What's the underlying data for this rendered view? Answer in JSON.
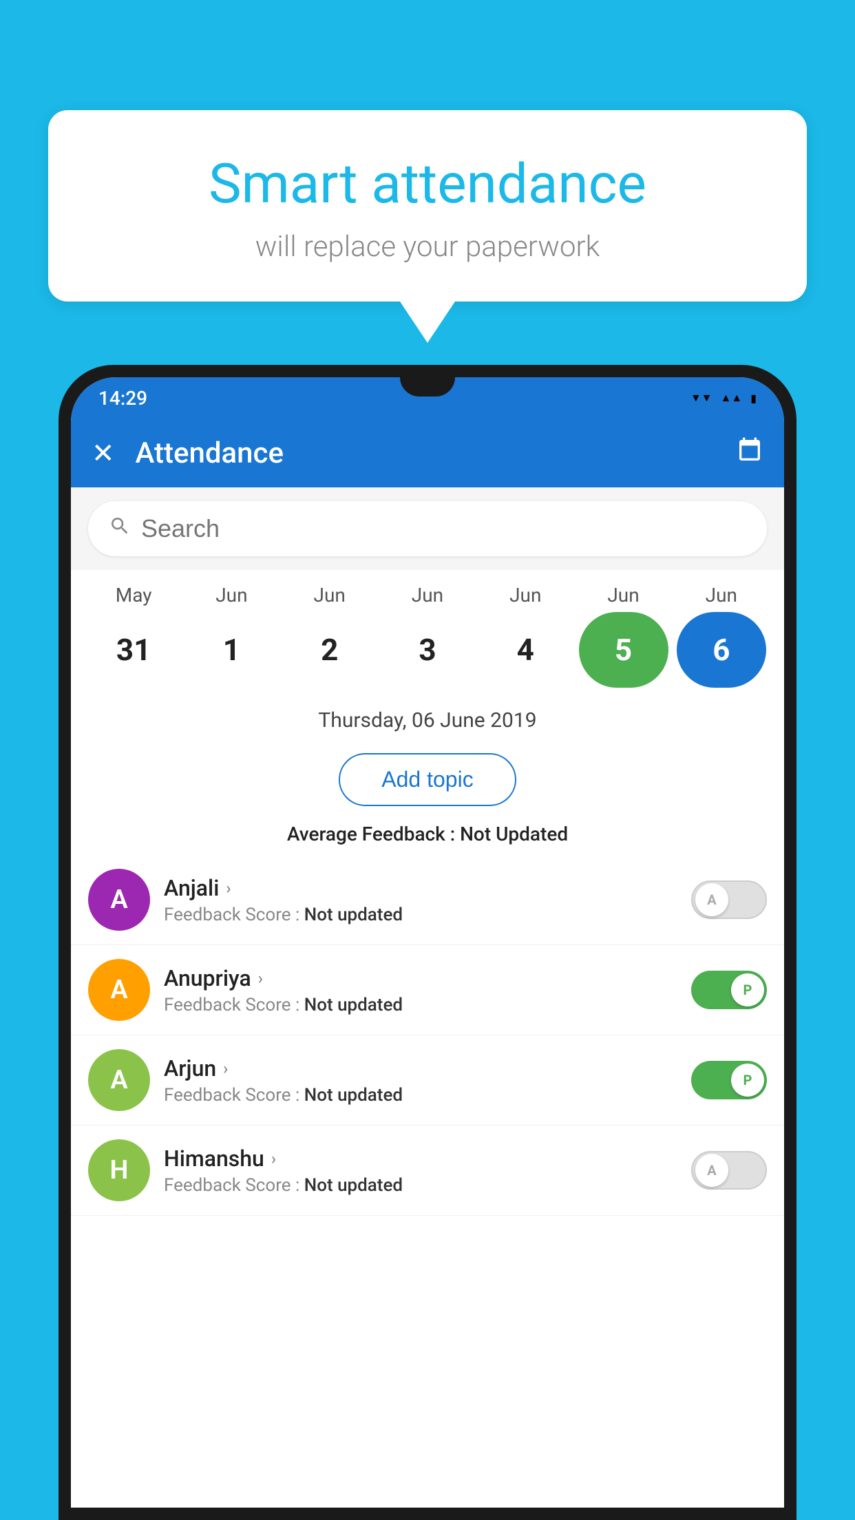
{
  "background": {
    "color": "#1bb8e8"
  },
  "speech_bubble": {
    "title": "Smart attendance",
    "subtitle": "will replace your paperwork"
  },
  "status_bar": {
    "time": "14:29",
    "wifi": "▲",
    "signal": "▲",
    "battery": "▮"
  },
  "app_bar": {
    "close_label": "✕",
    "title": "Attendance",
    "calendar_icon": "📅"
  },
  "search": {
    "placeholder": "Search"
  },
  "calendar": {
    "months": [
      "May",
      "Jun",
      "Jun",
      "Jun",
      "Jun",
      "Jun",
      "Jun"
    ],
    "dates": [
      "31",
      "1",
      "2",
      "3",
      "4",
      "5",
      "6"
    ],
    "states": [
      "normal",
      "normal",
      "normal",
      "normal",
      "normal",
      "today",
      "selected"
    ]
  },
  "selected_date": "Thursday, 06 June 2019",
  "add_topic": {
    "label": "Add topic"
  },
  "feedback_summary": {
    "label": "Average Feedback : ",
    "value": "Not Updated"
  },
  "students": [
    {
      "name": "Anjali",
      "avatar_letter": "A",
      "avatar_color": "#9c27b0",
      "feedback_label": "Feedback Score : ",
      "feedback_value": "Not updated",
      "toggle": "off",
      "toggle_label": "A"
    },
    {
      "name": "Anupriya",
      "avatar_letter": "A",
      "avatar_color": "#ffa000",
      "feedback_label": "Feedback Score : ",
      "feedback_value": "Not updated",
      "toggle": "on",
      "toggle_label": "P"
    },
    {
      "name": "Arjun",
      "avatar_letter": "A",
      "avatar_color": "#8bc34a",
      "feedback_label": "Feedback Score : ",
      "feedback_value": "Not updated",
      "toggle": "on",
      "toggle_label": "P"
    },
    {
      "name": "Himanshu",
      "avatar_letter": "H",
      "avatar_color": "#8bc34a",
      "feedback_label": "Feedback Score : ",
      "feedback_value": "Not updated",
      "toggle": "off",
      "toggle_label": "A"
    }
  ]
}
